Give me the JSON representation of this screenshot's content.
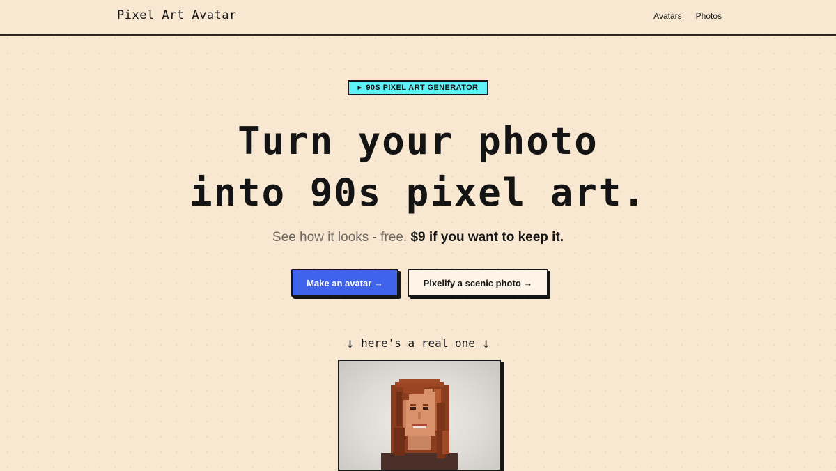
{
  "nav": {
    "brand": "Pixel Art Avatar",
    "links": [
      "Avatars",
      "Photos"
    ]
  },
  "hero": {
    "badge": "90S PIXEL ART GENERATOR",
    "headline_line1": "Turn your photo",
    "headline_line2": "into 90s pixel art.",
    "subtitle_plain": "See how it looks - free.",
    "subtitle_bold": "$9 if you want to keep it.",
    "primary_button": "Make an avatar →",
    "secondary_button": "Pixelify a scenic photo →",
    "example_label": "here's a real one"
  },
  "colors": {
    "background": "#f8e7d1",
    "accent_blue": "#3f63ea",
    "badge_cyan": "#5ef2f6",
    "ink": "#161616"
  },
  "icons": {
    "badge_marker": "play-triangle-icon",
    "label_arrows": "arrow-down-icon"
  }
}
